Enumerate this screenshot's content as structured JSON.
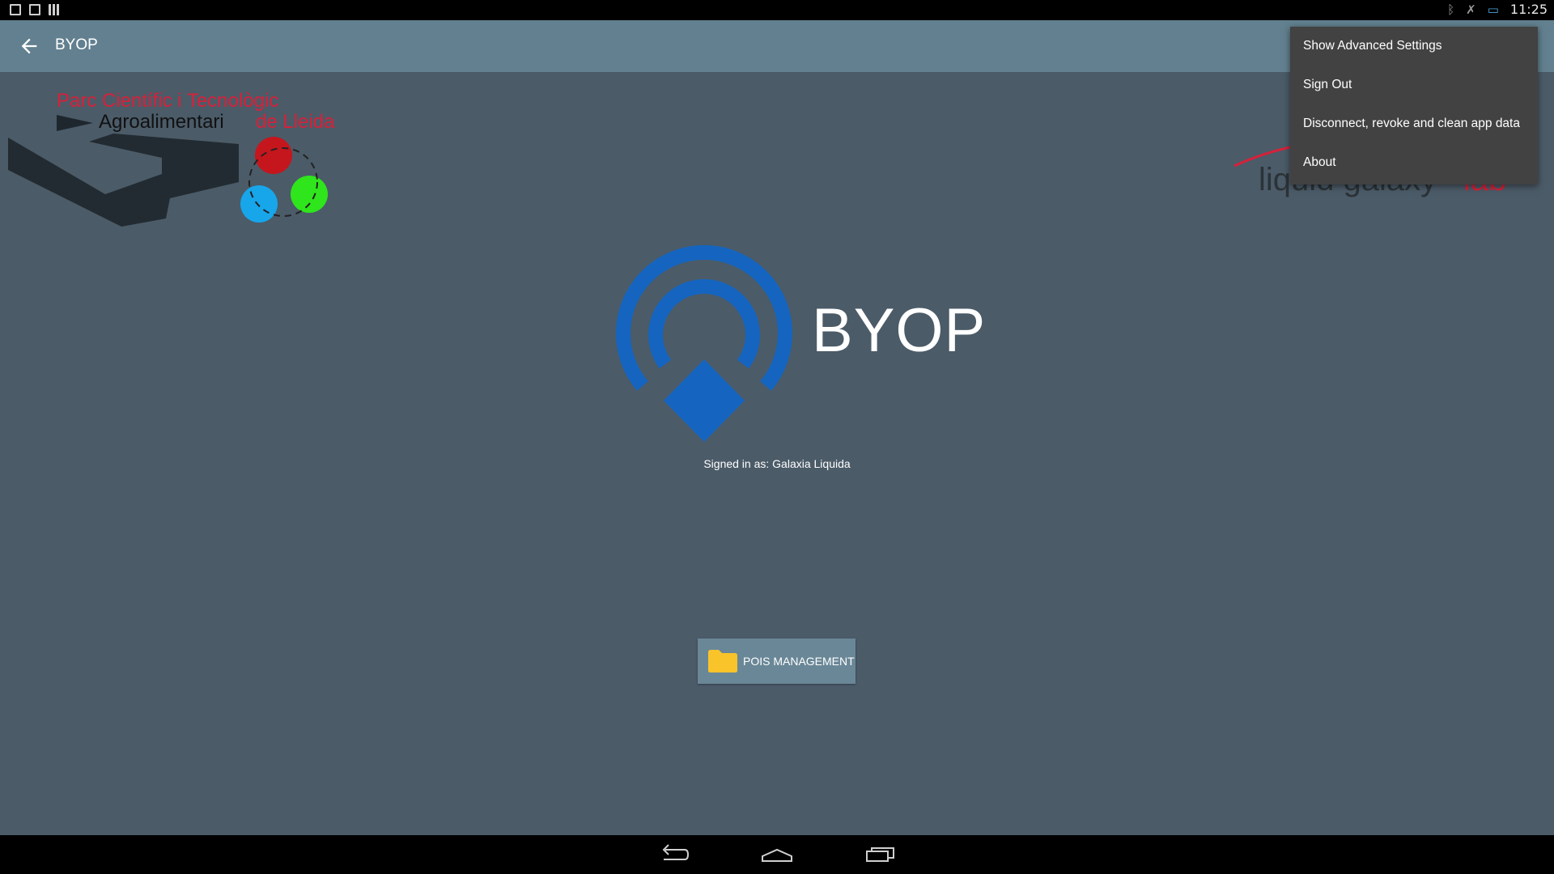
{
  "status_bar": {
    "time": "11:25",
    "left_icons": [
      "image-icon",
      "shop-bag-icon",
      "barcode-icon"
    ],
    "right_icons": [
      "bluetooth-icon",
      "no-signal-icon",
      "screen-cast-icon"
    ]
  },
  "app_bar": {
    "title": "BYOP",
    "back_icon": "arrow-left-icon"
  },
  "logos": {
    "parc": {
      "line1": "Parc Científic i Tecnològic",
      "line2_a": "Agroalimentari",
      "line2_b": "de Lleida"
    },
    "liquid_galaxy": {
      "text_a": "liquid galaxy",
      "text_b": "lab"
    }
  },
  "main": {
    "app_name": "BYOP",
    "signed_in_label": "Signed in as: Galaxia Liquida",
    "pois_button": "POIS MANAGEMENT"
  },
  "menu": {
    "items": [
      "Show Advanced Settings",
      "Sign Out",
      "Disconnect, revoke and clean app data",
      "About"
    ]
  },
  "colors": {
    "background": "#4b5b68",
    "app_bar": "#62808f",
    "logo_blue": "#1565c0",
    "menu_bg": "#424242",
    "folder": "#f9c32a"
  }
}
